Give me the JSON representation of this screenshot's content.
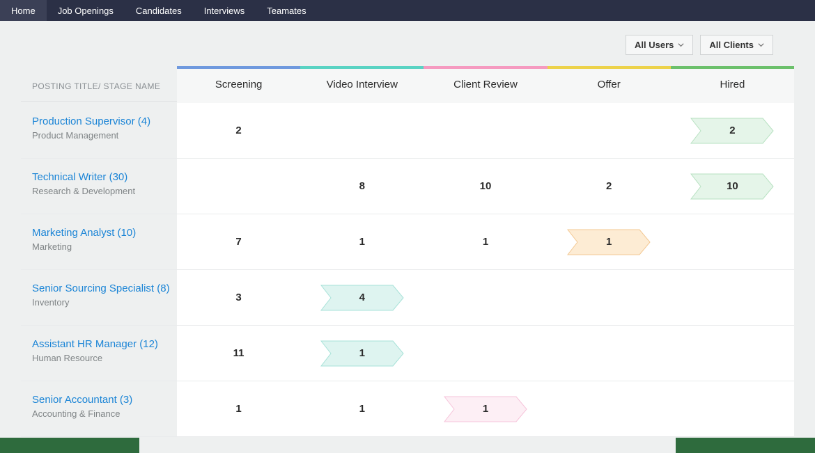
{
  "nav": {
    "tabs": [
      {
        "label": "Home",
        "active": true
      },
      {
        "label": "Job Openings",
        "active": false
      },
      {
        "label": "Candidates",
        "active": false
      },
      {
        "label": "Interviews",
        "active": false
      },
      {
        "label": "Teamates",
        "active": false
      }
    ]
  },
  "filters": {
    "users": "All Users",
    "clients": "All Clients"
  },
  "table_header": "POSTING TITLE/ STAGE NAME",
  "stages": [
    {
      "name": "Screening",
      "bar_color": "#6f99de",
      "tag_fill": "#e9f7f4",
      "tag_stroke": "#b9e6de"
    },
    {
      "name": "Video Interview",
      "bar_color": "#59d3c3",
      "tag_fill": "#def4f0",
      "tag_stroke": "#a7e2d8"
    },
    {
      "name": "Client Review",
      "bar_color": "#f59ac0",
      "tag_fill": "#fdeff5",
      "tag_stroke": "#f6c3da"
    },
    {
      "name": "Offer",
      "bar_color": "#ecd24a",
      "tag_fill": "#fdecd4",
      "tag_stroke": "#f3c893"
    },
    {
      "name": "Hired",
      "bar_color": "#6bc06b",
      "tag_fill": "#e5f5e9",
      "tag_stroke": "#b7e1c1"
    }
  ],
  "rows": [
    {
      "title": "Production Supervisor (4)",
      "dept": "Product Management",
      "cells": [
        {
          "value": "2",
          "tag": false
        },
        {
          "value": "",
          "tag": false
        },
        {
          "value": "",
          "tag": false
        },
        {
          "value": "",
          "tag": false
        },
        {
          "value": "2",
          "tag": true,
          "stage": 4
        }
      ]
    },
    {
      "title": "Technical Writer (30)",
      "dept": "Research & Development",
      "cells": [
        {
          "value": "",
          "tag": false
        },
        {
          "value": "8",
          "tag": false
        },
        {
          "value": "10",
          "tag": false
        },
        {
          "value": "2",
          "tag": false
        },
        {
          "value": "10",
          "tag": true,
          "stage": 4
        }
      ]
    },
    {
      "title": "Marketing Analyst (10)",
      "dept": "Marketing",
      "cells": [
        {
          "value": "7",
          "tag": false
        },
        {
          "value": "1",
          "tag": false
        },
        {
          "value": "1",
          "tag": false
        },
        {
          "value": "1",
          "tag": true,
          "stage": 3
        },
        {
          "value": "",
          "tag": false
        }
      ]
    },
    {
      "title": "Senior Sourcing Specialist (8)",
      "dept": "Inventory",
      "cells": [
        {
          "value": "3",
          "tag": false
        },
        {
          "value": "4",
          "tag": true,
          "stage": 1
        },
        {
          "value": "",
          "tag": false
        },
        {
          "value": "",
          "tag": false
        },
        {
          "value": "",
          "tag": false
        }
      ]
    },
    {
      "title": "Assistant HR Manager (12)",
      "dept": "Human Resource",
      "cells": [
        {
          "value": "11",
          "tag": false
        },
        {
          "value": "1",
          "tag": true,
          "stage": 1
        },
        {
          "value": "",
          "tag": false
        },
        {
          "value": "",
          "tag": false
        },
        {
          "value": "",
          "tag": false
        }
      ]
    },
    {
      "title": "Senior Accountant (3)",
      "dept": "Accounting & Finance",
      "cells": [
        {
          "value": "1",
          "tag": false
        },
        {
          "value": "1",
          "tag": false
        },
        {
          "value": "1",
          "tag": true,
          "stage": 2
        },
        {
          "value": "",
          "tag": false
        },
        {
          "value": "",
          "tag": false
        }
      ]
    }
  ]
}
